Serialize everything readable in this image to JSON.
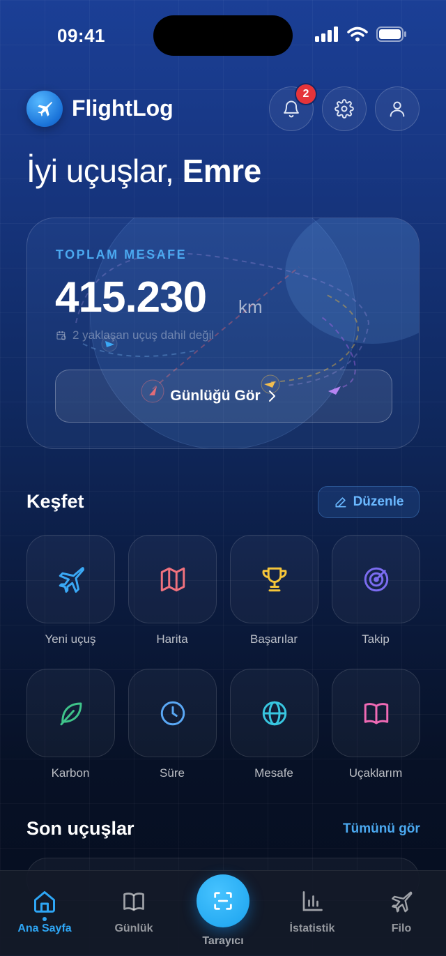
{
  "status": {
    "time": "09:41"
  },
  "header": {
    "app_name": "FlightLog",
    "notification_count": "2"
  },
  "greeting": {
    "prefix": "İyi uçuşlar, ",
    "name": "Emre"
  },
  "distance_card": {
    "label": "TOPLAM MESAFE",
    "value": "415.230",
    "unit": "km",
    "note": "2 yaklaşan uçuş dahil değil",
    "button_label": "Günlüğü Gör"
  },
  "explore": {
    "title": "Keşfet",
    "edit_label": "Düzenle",
    "tiles": [
      {
        "label": "Yeni uçuş",
        "icon": "plane-icon",
        "color": "#3aa8f5"
      },
      {
        "label": "Harita",
        "icon": "map-icon",
        "color": "#f0727e"
      },
      {
        "label": "Başarılar",
        "icon": "trophy-icon",
        "color": "#f5c53a"
      },
      {
        "label": "Takip",
        "icon": "radar-icon",
        "color": "#7b6cf0"
      },
      {
        "label": "Karbon",
        "icon": "leaf-icon",
        "color": "#3fc48a"
      },
      {
        "label": "Süre",
        "icon": "clock-icon",
        "color": "#5aa8f5"
      },
      {
        "label": "Mesafe",
        "icon": "globe-icon",
        "color": "#38c6e0"
      },
      {
        "label": "Uçaklarım",
        "icon": "book-icon",
        "color": "#f06ab5"
      }
    ]
  },
  "recent": {
    "title": "Son uçuşlar",
    "see_all": "Tümünü gör"
  },
  "tabbar": {
    "tabs": [
      {
        "label": "Ana Sayfa",
        "icon": "home-icon"
      },
      {
        "label": "Günlük",
        "icon": "book-open-icon"
      },
      {
        "label": "Tarayıcı",
        "icon": "scan-icon"
      },
      {
        "label": "İstatistik",
        "icon": "bar-chart-icon"
      },
      {
        "label": "Filo",
        "icon": "plane-icon"
      }
    ]
  },
  "colors": {
    "accent": "#2ea6f5",
    "badge": "#e5343a"
  }
}
